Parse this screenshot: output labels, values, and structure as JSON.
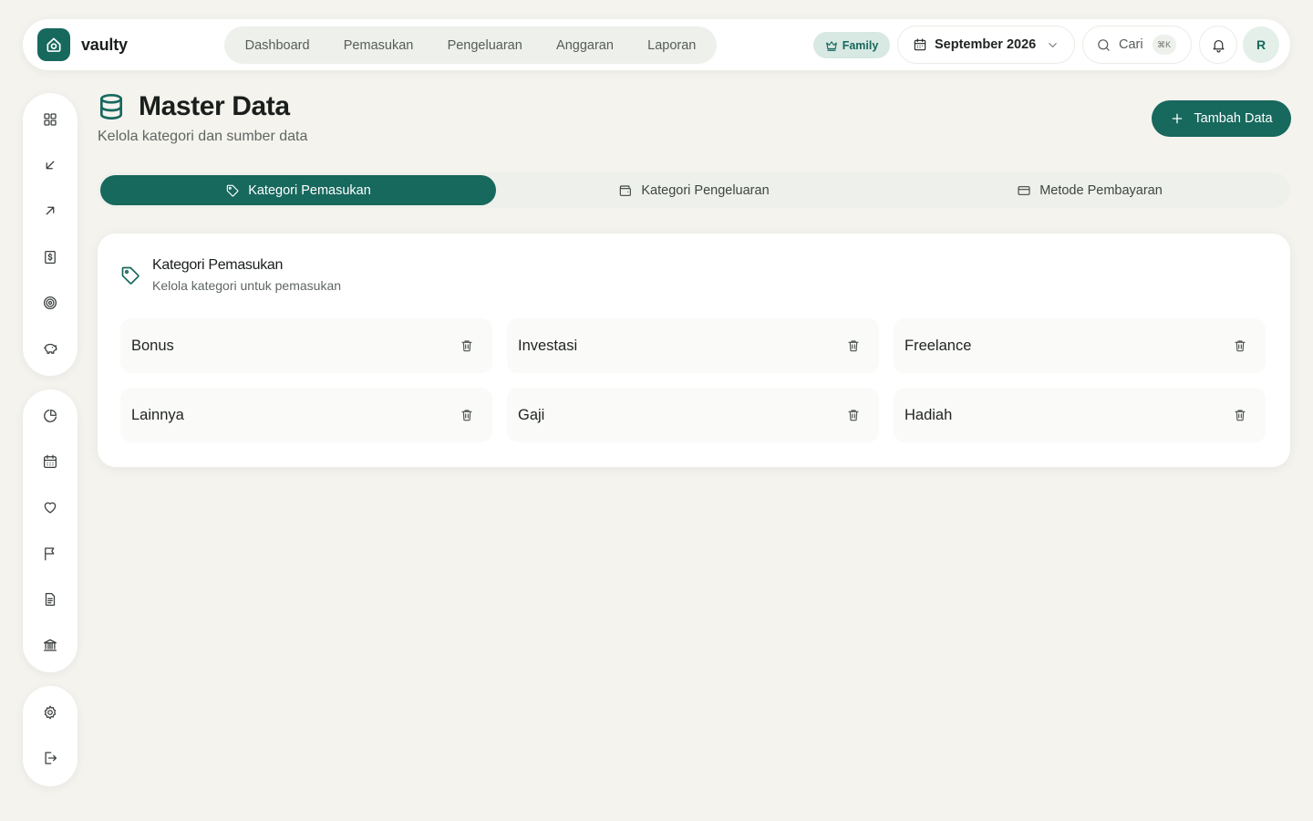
{
  "brand": {
    "name": "vaulty"
  },
  "nav": {
    "items": [
      "Dashboard",
      "Pemasukan",
      "Pengeluaran",
      "Anggaran",
      "Laporan"
    ]
  },
  "header": {
    "plan_badge": "Family",
    "month": "September 2026",
    "search_label": "Cari",
    "search_shortcut": "⌘K",
    "avatar_initial": "R"
  },
  "page": {
    "title": "Master Data",
    "subtitle": "Kelola kategori dan sumber data",
    "add_button": "Tambah Data"
  },
  "tabs": [
    {
      "label": "Kategori Pemasukan",
      "icon": "tag-icon",
      "active": true
    },
    {
      "label": "Kategori Pengeluaran",
      "icon": "wallet-icon",
      "active": false
    },
    {
      "label": "Metode Pembayaran",
      "icon": "credit-card-icon",
      "active": false
    }
  ],
  "card": {
    "title": "Kategori Pemasukan",
    "subtitle": "Kelola kategori untuk pemasukan",
    "items": [
      "Bonus",
      "Investasi",
      "Freelance",
      "Lainnya",
      "Gaji",
      "Hadiah"
    ]
  },
  "sidebar": {
    "group1": [
      "grid-icon",
      "arrow-down-left-icon",
      "arrow-up-right-icon",
      "receipt-dollar-icon",
      "target-icon",
      "piggy-bank-icon"
    ],
    "group2": [
      "pie-chart-icon",
      "calendar-icon",
      "heart-icon",
      "flag-icon",
      "document-icon",
      "bank-icon"
    ],
    "group3": [
      "settings-icon",
      "logout-icon"
    ]
  },
  "colors": {
    "accent": "#17685d",
    "background": "#f4f3ee",
    "surface": "#ffffff",
    "muted": "#eef0ec"
  }
}
